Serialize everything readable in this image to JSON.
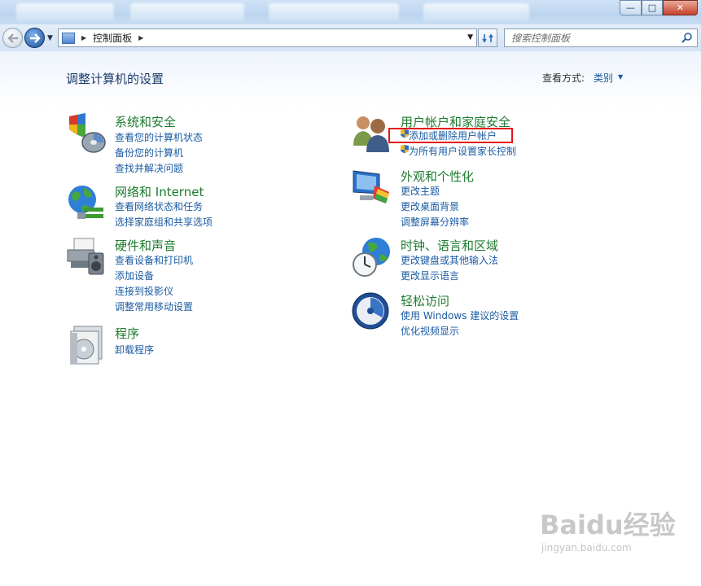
{
  "window": {
    "controls": {
      "minimize": "—",
      "maximize": "□",
      "close": "✕"
    }
  },
  "nav": {
    "back_icon": "back-arrow-icon",
    "forward_icon": "forward-arrow-icon",
    "address_segments": [
      "控制面板"
    ],
    "search_placeholder": "搜索控制面板"
  },
  "header": {
    "title": "调整计算机的设置",
    "view_by_label": "查看方式:",
    "view_by_value": "类别"
  },
  "categories_left": [
    {
      "title": "系统和安全",
      "icon": "shield-pc-icon",
      "links": [
        "查看您的计算机状态",
        "备份您的计算机",
        "查找并解决问题"
      ]
    },
    {
      "title": "网络和 Internet",
      "icon": "network-globe-icon",
      "links": [
        "查看网络状态和任务",
        "选择家庭组和共享选项"
      ]
    },
    {
      "title": "硬件和声音",
      "icon": "printer-speaker-icon",
      "links": [
        "查看设备和打印机",
        "添加设备",
        "连接到投影仪",
        "调整常用移动设置"
      ]
    },
    {
      "title": "程序",
      "icon": "programs-disc-icon",
      "links": [
        "卸载程序"
      ]
    }
  ],
  "categories_right": [
    {
      "title": "用户帐户和家庭安全",
      "icon": "users-icon",
      "links": [
        "添加或删除用户帐户",
        "为所有用户设置家长控制"
      ]
    },
    {
      "title": "外观和个性化",
      "icon": "monitor-palette-icon",
      "links": [
        "更改主题",
        "更改桌面背景",
        "调整屏幕分辨率"
      ]
    },
    {
      "title": "时钟、语言和区域",
      "icon": "clock-globe-icon",
      "links": [
        "更改键盘或其他输入法",
        "更改显示语言"
      ]
    },
    {
      "title": "轻松访问",
      "icon": "ease-of-access-icon",
      "links": [
        "使用 Windows 建议的设置",
        "优化视频显示"
      ]
    }
  ],
  "watermark": {
    "logo": "Baidu经验",
    "url": "jingyan.baidu.com"
  }
}
